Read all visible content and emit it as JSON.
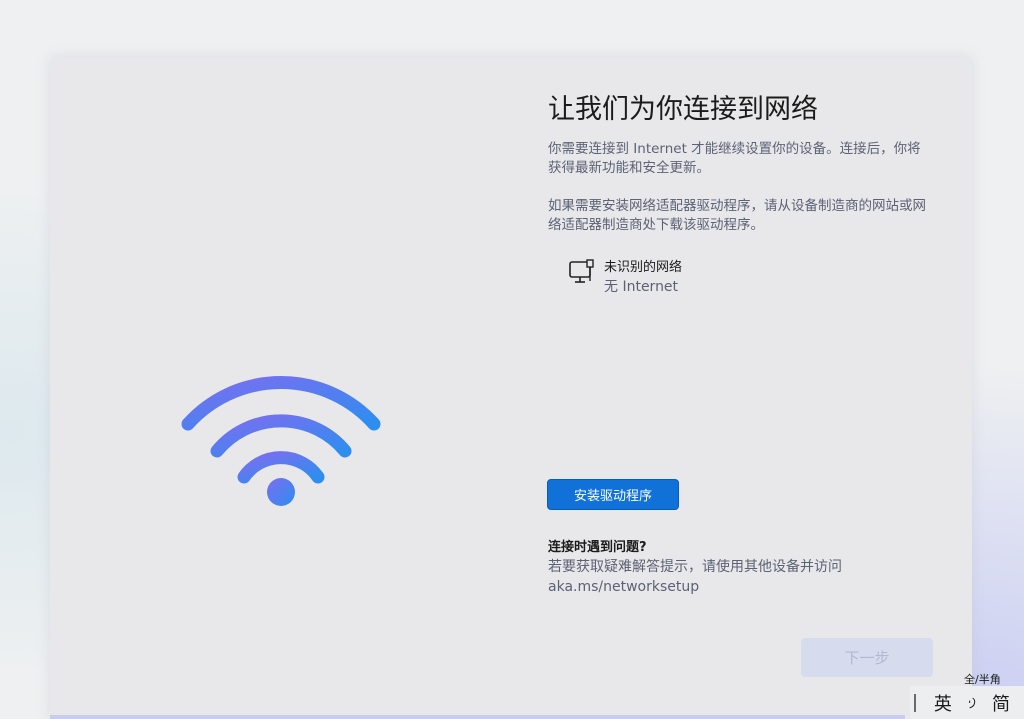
{
  "page": {
    "title": "让我们为你连接到网络",
    "paragraph1": "你需要连接到 Internet 才能继续设置你的设备。连接后，你将获得最新功能和安全更新。",
    "paragraph2": "如果需要安装网络适配器驱动程序，请从设备制造商的网站或网络适配器制造商处下载该驱动程序。"
  },
  "network": {
    "icon": "wired-network-icon",
    "name": "未识别的网络",
    "status": "无 Internet"
  },
  "actions": {
    "install_driver_label": "安装驱动程序",
    "next_label": "下一步"
  },
  "help": {
    "title": "连接时遇到问题?",
    "text": "若要获取疑难解答提示，请使用其他设备并访问 aka.ms/networksetup"
  },
  "ime": {
    "hint": "全/半角",
    "mode": "英",
    "width_icon": "half-width-moon-icon",
    "script": "简"
  },
  "colors": {
    "accent": "#1071d8",
    "wifi_gradient_start": "#7b6ef0",
    "wifi_gradient_end": "#2d8ef0"
  }
}
